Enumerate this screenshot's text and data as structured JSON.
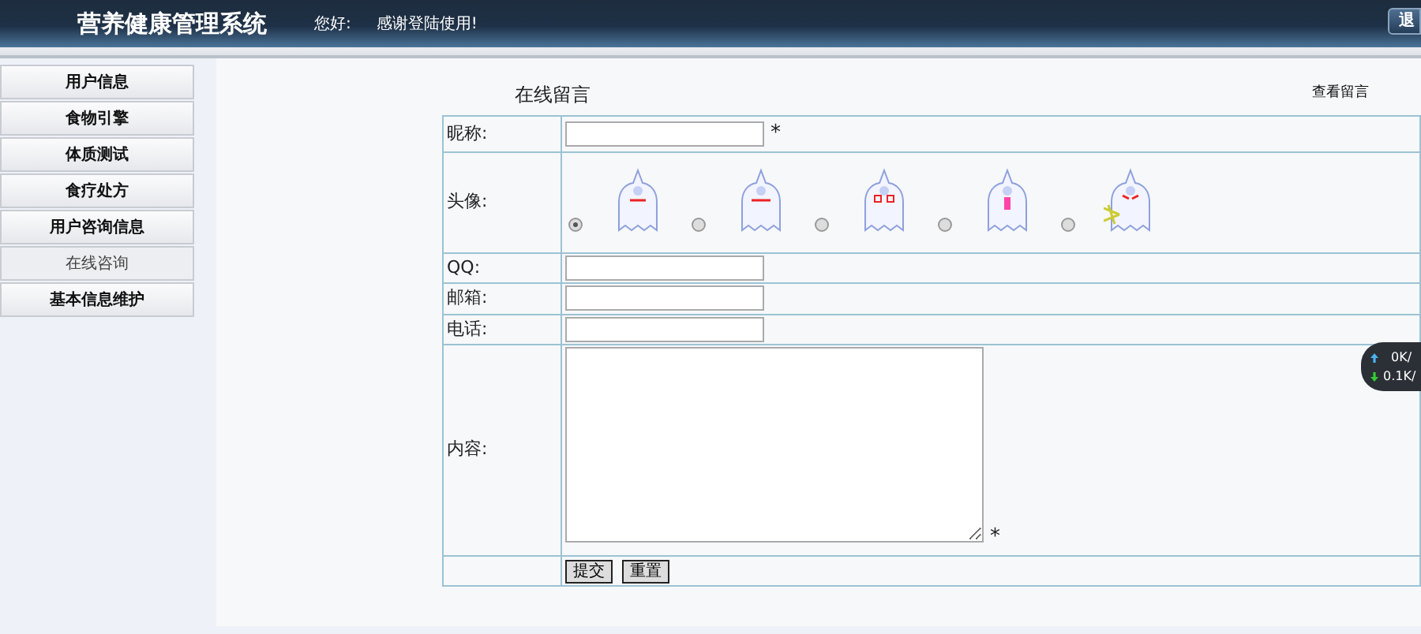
{
  "header": {
    "title": "营养健康管理系统",
    "greeting": "您好:",
    "welcome": "感谢登陆使用!",
    "logout": "退"
  },
  "sidebar": {
    "items": [
      {
        "label": "用户信息",
        "kind": "header"
      },
      {
        "label": "食物引擎",
        "kind": "header"
      },
      {
        "label": "体质测试",
        "kind": "header"
      },
      {
        "label": "食疗处方",
        "kind": "header"
      },
      {
        "label": "用户咨询信息",
        "kind": "header"
      },
      {
        "label": "在线咨询",
        "kind": "sub"
      },
      {
        "label": "基本信息维护",
        "kind": "header"
      }
    ]
  },
  "form": {
    "title": "在线留言",
    "view_link": "查看留言",
    "rows": [
      {
        "kind": "text",
        "label": "昵称:",
        "required": true,
        "required_mark": "*"
      },
      {
        "kind": "avatar",
        "label": "头像:",
        "avatars": [
          {
            "selected": true
          },
          {
            "selected": false
          },
          {
            "selected": false
          },
          {
            "selected": false
          },
          {
            "selected": false
          }
        ]
      },
      {
        "kind": "text",
        "label": "QQ:",
        "required": false
      },
      {
        "kind": "text",
        "label": "邮箱:",
        "required": false
      },
      {
        "kind": "text",
        "label": "电话:",
        "required": false
      },
      {
        "kind": "textarea",
        "label": "内容:",
        "required": true,
        "required_mark": "*"
      },
      {
        "kind": "buttons",
        "buttons": [
          "提交",
          "重置"
        ]
      }
    ]
  },
  "speed_widget": {
    "upload": "0K/",
    "download": "0.1K/"
  }
}
